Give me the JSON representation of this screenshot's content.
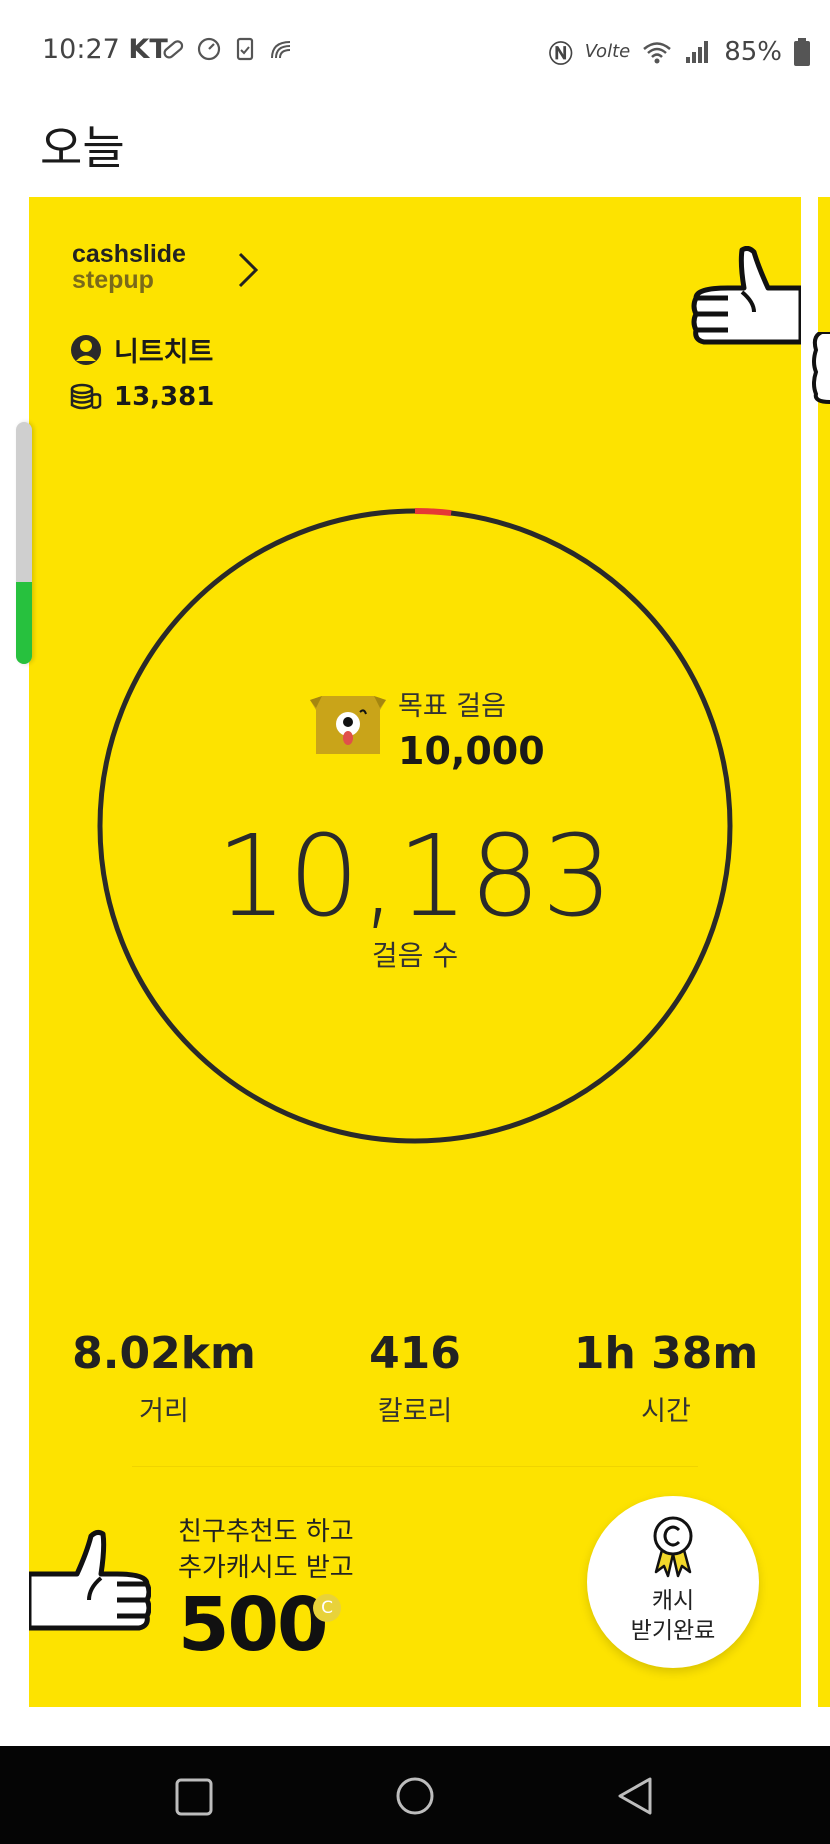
{
  "status_bar": {
    "time": "10:27",
    "carrier": "KT",
    "network": "Volte",
    "battery": "85%"
  },
  "page": {
    "title": "오늘"
  },
  "card": {
    "brand_top": "cashslide",
    "brand_bottom": "stepup",
    "user_name": "니트치트",
    "coins": "13,381",
    "goal_label": "목표 걸음",
    "goal_value": "10,000",
    "steps": "10,183",
    "steps_label": "걸음 수",
    "goal_progress": 1.0183,
    "stats": [
      {
        "value": "8.02km",
        "label": "거리"
      },
      {
        "value": "416",
        "label": "칼로리"
      },
      {
        "value": "1h 38m",
        "label": "시간"
      }
    ],
    "promo_line1": "친구추천도 하고",
    "promo_line2": "추가캐시도 받고",
    "promo_amount": "500",
    "promo_coin": "C",
    "cash_button_line1": "캐시",
    "cash_button_line2": "받기완료"
  },
  "colors": {
    "card_bg": "#fde300",
    "progress_over": "#e53935",
    "scroll_fill": "#27c13e"
  }
}
